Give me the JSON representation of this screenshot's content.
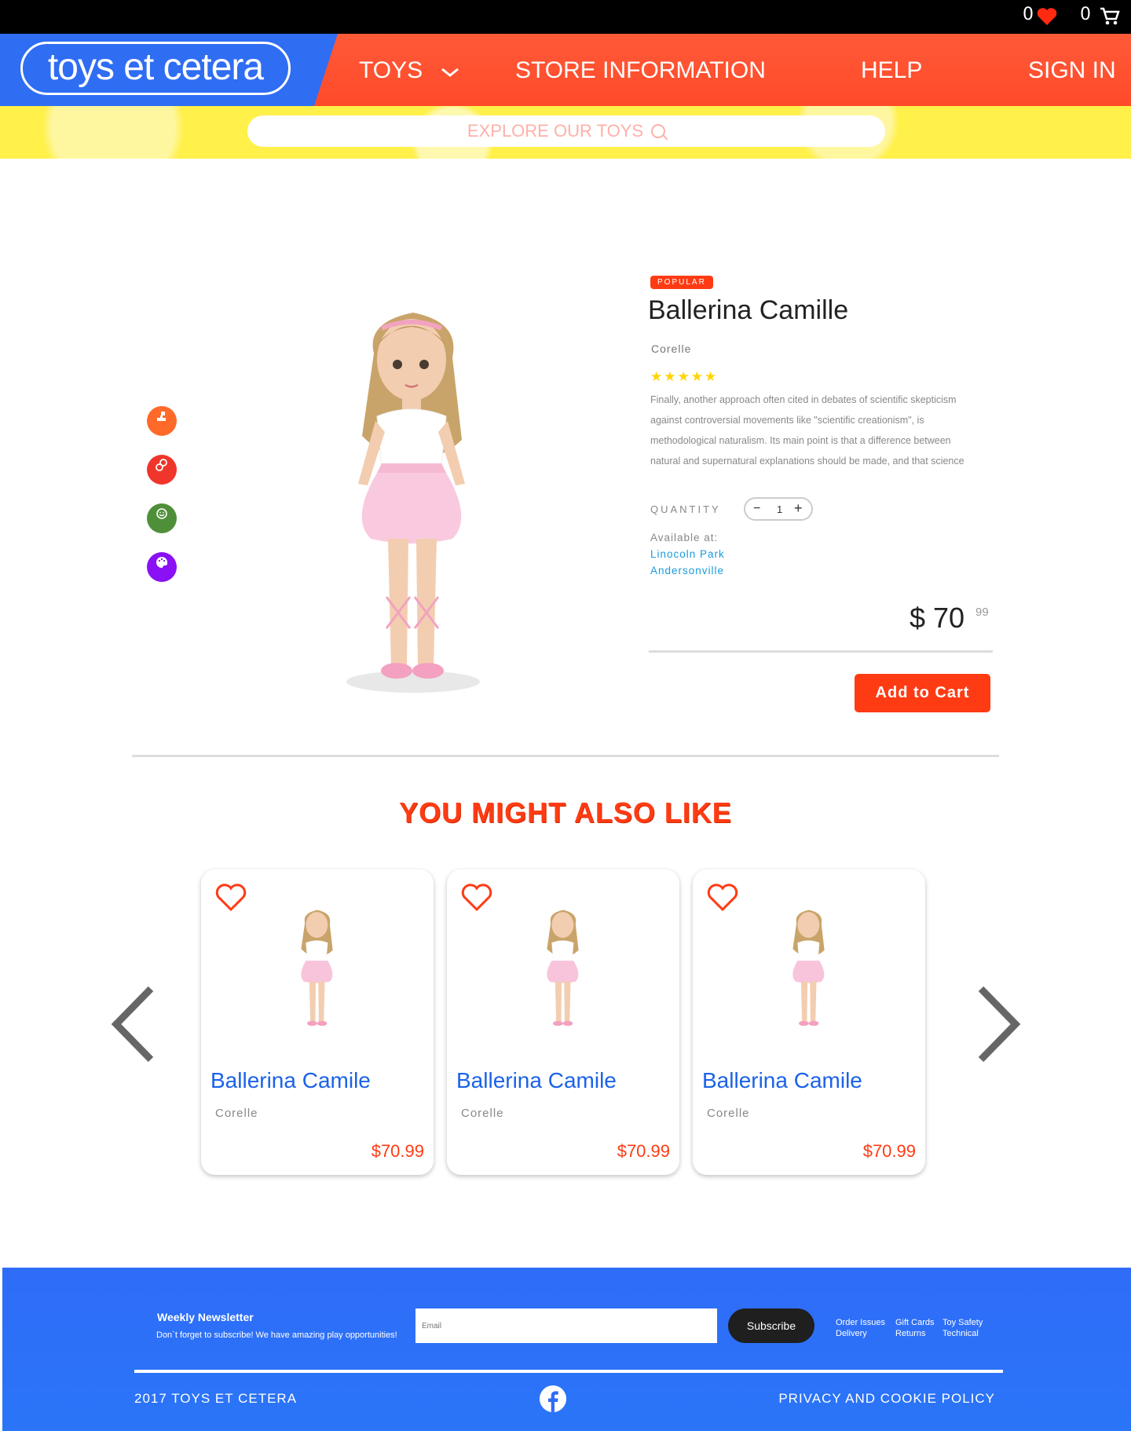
{
  "topbar": {
    "wishlist_count": "0",
    "cart_count": "0"
  },
  "header": {
    "logo": "toys et cetera",
    "nav": {
      "toys": "TOYS",
      "store": "STORE INFORMATION",
      "help": "HELP",
      "signin": "SIGN IN"
    }
  },
  "search": {
    "placeholder": "EXPLORE OUR TOYS"
  },
  "product": {
    "badge": "POPULAR",
    "title": "Ballerina Camille",
    "brand": "Corelle",
    "rating": 5,
    "stars": "★★★★★",
    "description": "Finally, another approach often cited in debates of scientific skepticism against controversial movements like \"scientific creationism\", is methodological naturalism. Its main point is that a difference between natural and supernatural explanations should be made, and that science",
    "quantity_label": "QUANTITY",
    "quantity": "1",
    "minus": "−",
    "plus": "+",
    "available_label": "Available at:",
    "locations": [
      "Linocoln Park",
      "Andersonville"
    ],
    "price_main": "$ 70",
    "price_cents": "99",
    "add_to_cart": "Add to Cart"
  },
  "related": {
    "heading": "YOU MIGHT ALSO LIKE",
    "items": [
      {
        "title": "Ballerina Camile",
        "brand": "Corelle",
        "price": "$70.99"
      },
      {
        "title": "Ballerina Camile",
        "brand": "Corelle",
        "price": "$70.99"
      },
      {
        "title": "Ballerina Camile",
        "brand": "Corelle",
        "price": "$70.99"
      }
    ]
  },
  "footer": {
    "newsletter_title": "Weekly Newsletter",
    "newsletter_sub": "Don`t forget to subscribe! We have amazing play opportunities!",
    "email_placeholder": "Email",
    "subscribe": "Subscribe",
    "links": [
      [
        "Order Issues",
        "Delivery"
      ],
      [
        "Gift Cards",
        "Returns"
      ],
      [
        "Toy Safety",
        "Technical"
      ]
    ],
    "copyright": "2017 TOYS ET CETERA",
    "privacy": "PRIVACY AND COOKIE POLICY"
  },
  "colors": {
    "accent": "#ff3b14",
    "brand_blue": "#2f6df3",
    "link_blue": "#1b62e8"
  }
}
